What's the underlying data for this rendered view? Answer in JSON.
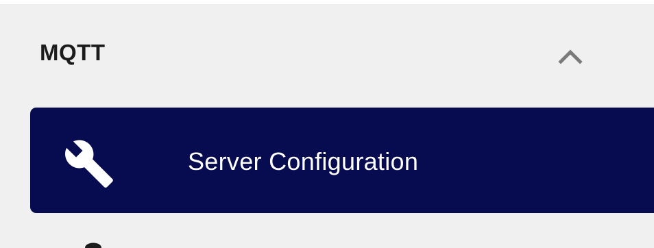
{
  "section": {
    "title": "MQTT",
    "expanded": true,
    "chevron_icon": "chevron-up-icon"
  },
  "nav": {
    "items": [
      {
        "label": "Server Configuration",
        "icon": "wrench-icon",
        "active": true
      }
    ]
  },
  "colors": {
    "sidebar_bg": "#f0f0f0",
    "active_item_bg": "#070b4f",
    "active_item_text": "#ffffff",
    "section_title": "#1c1c1c",
    "chevron": "#7a7a7a"
  }
}
